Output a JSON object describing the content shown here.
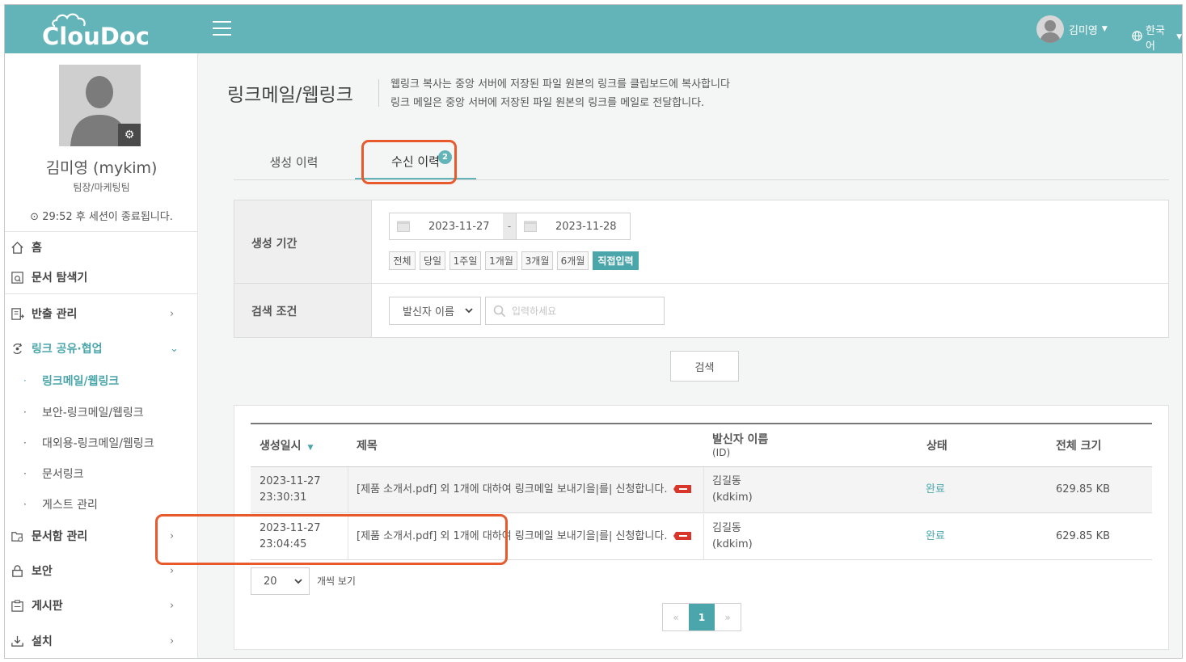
{
  "app": {
    "logo": "ClouDoc"
  },
  "topbar": {
    "user_name": "김미영",
    "language": "한국어"
  },
  "profile": {
    "name": "김미영 (mykim)",
    "dept": "팀장/마케팅팀",
    "session": "29:52 후 세션이 종료됩니다."
  },
  "sidebar": {
    "home": "홈",
    "explorer": "문서 탐색기",
    "export": "반출 관리",
    "link_share": "링크 공유·협업",
    "sub": [
      "링크메일/웹링크",
      "보안-링크메일/웹링크",
      "대외용-링크메일/웹링크",
      "문서링크",
      "게스트 관리"
    ],
    "docbox": "문서함 관리",
    "security": "보안",
    "board": "게시판",
    "settings": "설치"
  },
  "page": {
    "title": "링크메일/웹링크",
    "desc_1": "웹링크 복사는 중앙 서버에 저장된 파일 원본의 링크를 클립보드에 복사합니다",
    "desc_2": "링크 메일은 중앙 서버에 저장된 파일 원본의 링크를 메일로 전달합니다."
  },
  "tabs": {
    "created": "생성 이력",
    "received": "수신 이력",
    "received_badge": "2"
  },
  "filter": {
    "period_label": "생성 기간",
    "date_from": "2023-11-27",
    "date_to": "2023-11-28",
    "date_sep": "-",
    "ranges": [
      "전체",
      "당일",
      "1주일",
      "1개월",
      "3개월",
      "6개월",
      "직접입력"
    ],
    "condition_label": "검색 조건",
    "select_value": "발신자 이름",
    "search_placeholder": "입력하세요"
  },
  "search_button": "검색",
  "table": {
    "headers": {
      "created_at": "생성일시",
      "subject": "제목",
      "sender": "발신자 이름",
      "sender_sub": "(ID)",
      "status": "상태",
      "size": "전체 크기"
    },
    "rows": [
      {
        "date": "2023-11-27",
        "time": "23:30:31",
        "subject": "[제품 소개서.pdf] 외 1개에 대하여 링크메일 보내기을|를| 신청합니다.",
        "sender_name": "김길동",
        "sender_id": "(kdkim)",
        "status": "완료",
        "size": "629.85 KB"
      },
      {
        "date": "2023-11-27",
        "time": "23:04:45",
        "subject": "[제품 소개서.pdf] 외 1개에 대하여 링크메일 보내기을|를| 신청합니다.",
        "sender_name": "김길동",
        "sender_id": "(kdkim)",
        "status": "완료",
        "size": "629.85 KB"
      }
    ]
  },
  "pagination": {
    "page_size": "20",
    "page_size_label": "개씩 보기",
    "prev": "«",
    "current": "1",
    "next": "»"
  },
  "colors": {
    "brand": "#63b4b8",
    "accent": "#4aa6ab",
    "highlight": "#e8592c"
  }
}
